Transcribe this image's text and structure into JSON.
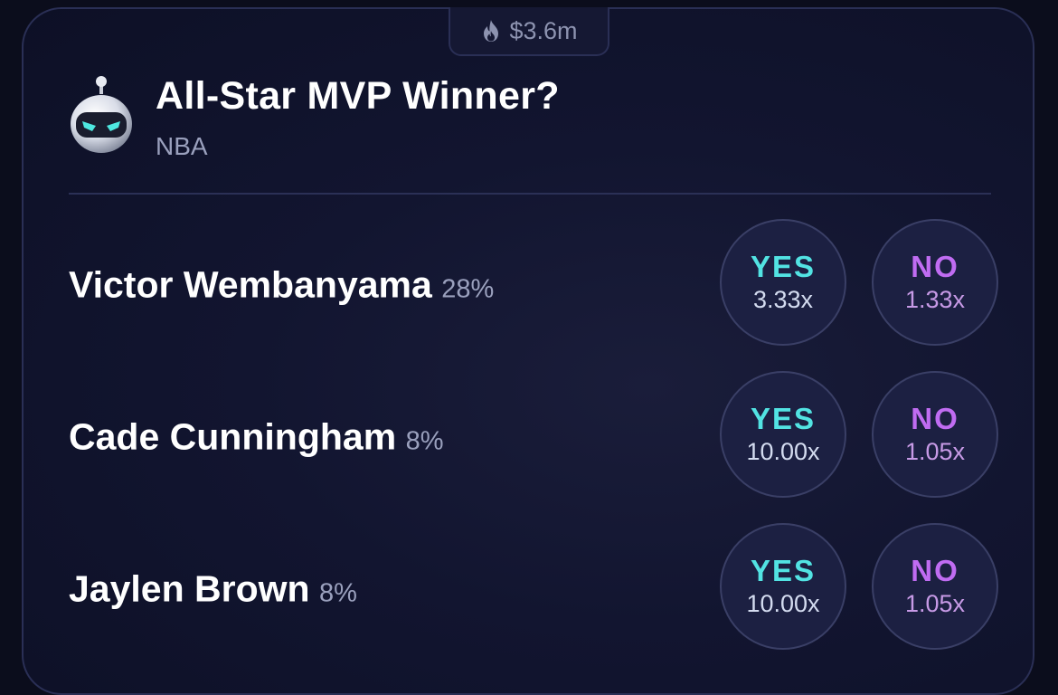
{
  "market": {
    "volume": "$3.6m",
    "title": "All-Star MVP Winner?",
    "category": "NBA"
  },
  "icons": {
    "volume": "flame-icon",
    "avatar": "robot-avatar-icon"
  },
  "colors": {
    "background": "#0b0d1c",
    "card": "#121530",
    "yes": "#52e3e3",
    "no": "#c06cf2",
    "button_bg": "#1c2042",
    "border": "#2a2f55"
  },
  "rows": [
    {
      "name": "Victor Wembanyama",
      "pct": "28%",
      "yes_label": "YES",
      "yes_mult": "3.33x",
      "no_label": "NO",
      "no_mult": "1.33x"
    },
    {
      "name": "Cade Cunningham",
      "pct": "8%",
      "yes_label": "YES",
      "yes_mult": "10.00x",
      "no_label": "NO",
      "no_mult": "1.05x"
    },
    {
      "name": "Jaylen Brown",
      "pct": "8%",
      "yes_label": "YES",
      "yes_mult": "10.00x",
      "no_label": "NO",
      "no_mult": "1.05x"
    }
  ]
}
